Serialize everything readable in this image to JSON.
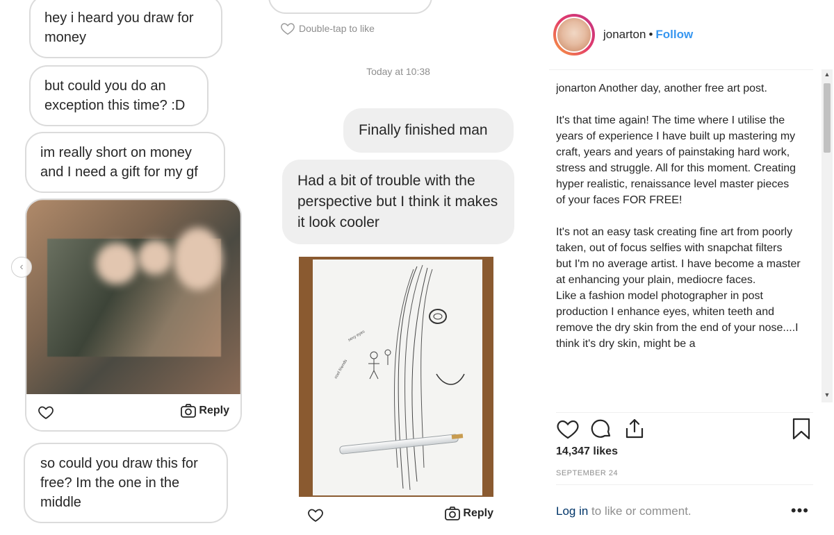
{
  "left_chat": {
    "messages": [
      "hey i heard you draw for money",
      "but could you do an exception this time? :D",
      "im really short on money and I need a gift for my gf",
      "so could you draw this for free? Im the one in the middle"
    ],
    "photo_reply_label": "Reply"
  },
  "middle_chat": {
    "double_tap_label": "Double-tap to like",
    "timestamp": "Today at 10:38",
    "messages": [
      "Finally finished man",
      "Had a bit of trouble with the perspective but I think it makes it look cooler"
    ],
    "drawing_reply_label": "Reply"
  },
  "post": {
    "username": "jonarton",
    "separator": "•",
    "follow_label": "Follow",
    "caption_user": "jonarton",
    "caption_lines": [
      "Another day, another free art post.",
      "",
      "It's that time again! The time where I utilise the years of experience I have built up mastering my craft, years and years of painstaking hard work, stress and struggle. All for this moment. Creating hyper realistic, renaissance level master pieces of your faces FOR FREE!",
      "",
      "It's not an easy task creating fine art from poorly taken, out of focus selfies with snapchat filters but I'm no average artist. I have become a master at enhancing your plain, mediocre faces.",
      "Like a fashion model photographer in post production I enhance eyes, whiten teeth and remove the dry skin from the end of your nose....I think it's dry skin, might be a"
    ],
    "likes": "14,347 likes",
    "date": "SEPTEMBER 24",
    "login_link": "Log in",
    "login_rest": " to like or comment.",
    "more_label": "•••",
    "icons": [
      "heart-icon",
      "comment-icon",
      "share-icon",
      "bookmark-icon"
    ]
  }
}
